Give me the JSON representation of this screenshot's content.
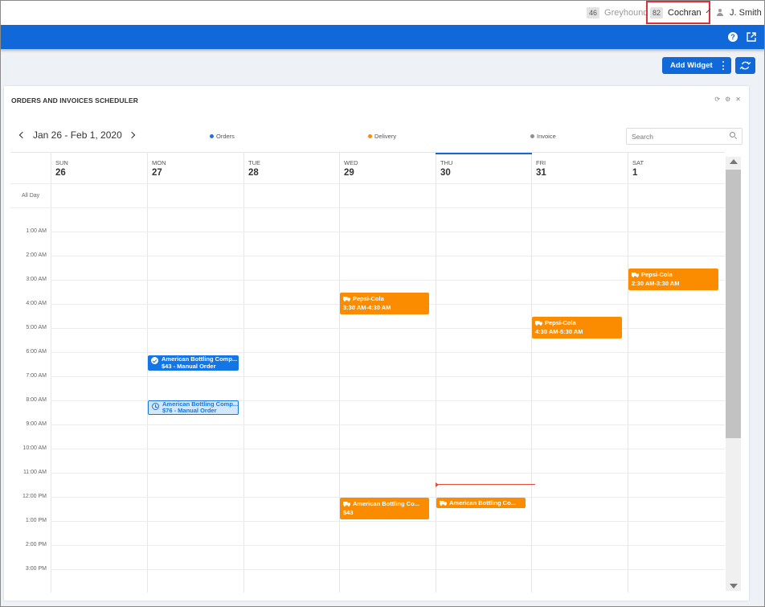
{
  "accounts": [
    {
      "badge": "46",
      "name": "Greyhound"
    },
    {
      "badge": "82",
      "name": "Cochran"
    }
  ],
  "user": {
    "name": "J. Smith"
  },
  "toolbar": {
    "add_widget_label": "Add Widget"
  },
  "widget": {
    "title": "ORDERS AND INVOICES SCHEDULER",
    "date_range": "Jan 26 - Feb 1, 2020",
    "legend": [
      {
        "label": "Orders",
        "color": "#1476e6"
      },
      {
        "label": "Delivery",
        "color": "#fb8c00"
      },
      {
        "label": "Invoice",
        "color": "#8a8f99"
      }
    ],
    "search_placeholder": "Search",
    "all_day_label": "All Day",
    "days": [
      {
        "name": "SUN",
        "num": "26"
      },
      {
        "name": "MON",
        "num": "27"
      },
      {
        "name": "TUE",
        "num": "28"
      },
      {
        "name": "WED",
        "num": "29"
      },
      {
        "name": "THU",
        "num": "30"
      },
      {
        "name": "FRI",
        "num": "31"
      },
      {
        "name": "SAT",
        "num": "1"
      }
    ],
    "times": [
      "1:00 AM",
      "2:00 AM",
      "3:00 AM",
      "4:00 AM",
      "5:00 AM",
      "6:00 AM",
      "7:00 AM",
      "8:00 AM",
      "9:00 AM",
      "10:00 AM",
      "11:00 AM",
      "12:00 PM",
      "1:00 PM",
      "2:00 PM",
      "3:00 PM"
    ],
    "events": [
      {
        "title": "Pepsi-Cola",
        "detail": "3:30 AM-4:30 AM",
        "type": "delivery"
      },
      {
        "title": "Pepsi-Cola",
        "detail": "4:30 AM-5:30 AM",
        "type": "delivery"
      },
      {
        "title": "Pepsi-Cola",
        "detail": "2:30 AM-3:30 AM",
        "type": "delivery"
      },
      {
        "title": "American Bottling Comp...",
        "detail": "$43 - Manual Order",
        "type": "order-confirmed"
      },
      {
        "title": "American Bottling Comp...",
        "detail": "$76 - Manual Order",
        "type": "order-pending"
      },
      {
        "title": "American Bottling Co...",
        "detail": "$43",
        "type": "delivery"
      },
      {
        "title": "American Bottling Co...",
        "detail": "",
        "type": "delivery"
      }
    ]
  }
}
